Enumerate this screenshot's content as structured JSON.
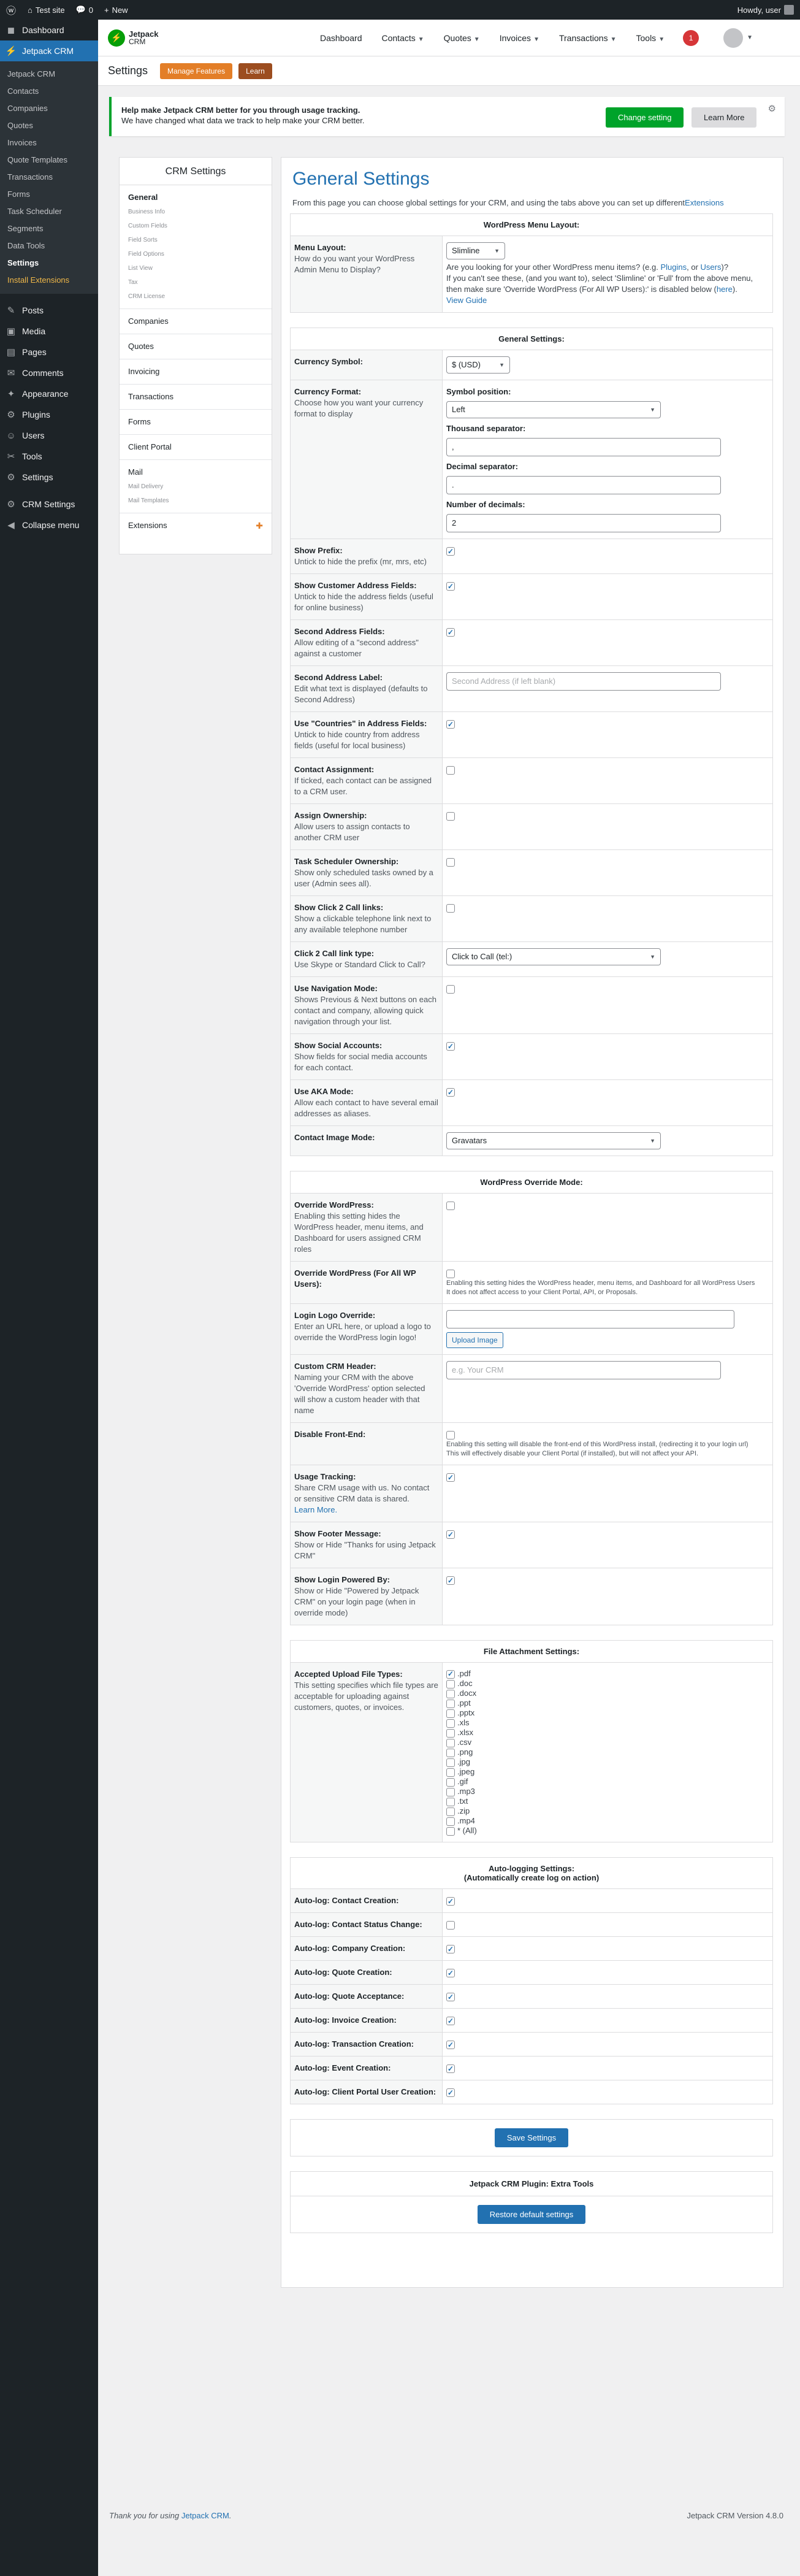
{
  "adminbar": {
    "site": "Test site",
    "comments": "0",
    "new": "New",
    "howdy": "Howdy, user"
  },
  "sidebar": {
    "top": [
      {
        "icon": "◼",
        "label": "Dashboard"
      }
    ],
    "crm_label": "Jetpack CRM",
    "crm_sub": [
      "Jetpack CRM",
      "Contacts",
      "Companies",
      "Quotes",
      "Invoices",
      "Quote Templates",
      "Transactions",
      "Forms",
      "Task Scheduler",
      "Segments",
      "Data Tools",
      "Settings",
      "Install Extensions"
    ],
    "bottom": [
      {
        "icon": "✎",
        "label": "Posts"
      },
      {
        "icon": "▣",
        "label": "Media"
      },
      {
        "icon": "▤",
        "label": "Pages"
      },
      {
        "icon": "✉",
        "label": "Comments"
      },
      {
        "icon": "✦",
        "label": "Appearance"
      },
      {
        "icon": "⚙",
        "label": "Plugins"
      },
      {
        "icon": "☺",
        "label": "Users"
      },
      {
        "icon": "✂",
        "label": "Tools"
      },
      {
        "icon": "⚙",
        "label": "Settings"
      },
      {
        "icon": "⚙",
        "label": "CRM Settings"
      },
      {
        "icon": "◀",
        "label": "Collapse menu"
      }
    ]
  },
  "topnav": {
    "brand1": "Jetpack",
    "brand2": "CRM",
    "links": [
      "Dashboard",
      "Contacts",
      "Quotes",
      "Invoices",
      "Transactions",
      "Tools"
    ],
    "notif": "1"
  },
  "subbar": {
    "title": "Settings",
    "manage": "Manage Features",
    "learn": "Learn"
  },
  "notice": {
    "line1": "Help make Jetpack CRM better for you through usage tracking.",
    "line2": "We have changed what data we track to help make your CRM better.",
    "btn_change": "Change setting",
    "btn_learn": "Learn More"
  },
  "snav": {
    "title": "CRM Settings",
    "groups": [
      {
        "main": "General",
        "subs": [
          "Business Info",
          "Custom Fields",
          "Field Sorts",
          "Field Options",
          "List View",
          "Tax",
          "CRM License"
        ]
      },
      {
        "main": "Companies",
        "subs": []
      },
      {
        "main": "Quotes",
        "subs": []
      },
      {
        "main": "Invoicing",
        "subs": []
      },
      {
        "main": "Transactions",
        "subs": []
      },
      {
        "main": "Forms",
        "subs": []
      },
      {
        "main": "Client Portal",
        "subs": []
      },
      {
        "main": "Mail",
        "subs": [
          "Mail Delivery",
          "Mail Templates"
        ]
      }
    ],
    "extensions": "Extensions"
  },
  "panel": {
    "title": "General Settings",
    "intro": "From this page you can choose global settings for your CRM, and using the tabs above you can set up different",
    "intro_link": "Extensions",
    "menu_layout": {
      "header": "WordPress Menu Layout:",
      "label": "Menu Layout:",
      "desc": "How do you want your WordPress Admin Menu to Display?",
      "value": "Slimline",
      "help1": "Are you looking for your other WordPress menu items? (e.g.",
      "plugins": "Plugins",
      "or": ", or",
      "users": "Users",
      "help1b": ")?",
      "help2": "If you can't see these, (and you want to), select 'Slimline' or 'Full' from the above menu, then make sure 'Override WordPress (For All WP Users):' is disabled below",
      "here": "here",
      "help3": ".",
      "guide": "View Guide"
    },
    "general": {
      "header": "General Settings:",
      "currency_label": "Currency Symbol:",
      "currency_value": "$ (USD)",
      "format_label": "Currency Format:",
      "format_desc": "Choose how you want your currency format to display",
      "symbol_pos_label": "Symbol position:",
      "symbol_pos_value": "Left",
      "thousand_label": "Thousand separator:",
      "thousand_value": ",",
      "decimal_label": "Decimal separator:",
      "decimal_value": ".",
      "decimals_label": "Number of decimals:",
      "decimals_value": "2"
    },
    "rows": [
      {
        "label": "Show Prefix:",
        "desc": "Untick to hide the prefix (mr, mrs, etc)",
        "type": "check",
        "on": true
      },
      {
        "label": "Show Customer Address Fields:",
        "desc": "Untick to hide the address fields (useful for online business)",
        "type": "check",
        "on": true
      },
      {
        "label": "Second Address Fields:",
        "desc": "Allow editing of a \"second address\" against a customer",
        "type": "check",
        "on": true
      },
      {
        "label": "Second Address Label:",
        "desc": "Edit what text is displayed (defaults to Second Address)",
        "type": "input",
        "placeholder": "Second Address (if left blank)"
      },
      {
        "label": "Use \"Countries\" in Address Fields:",
        "desc": "Untick to hide country from address fields (useful for local business)",
        "type": "check",
        "on": true
      },
      {
        "label": "Contact Assignment:",
        "desc": "If ticked, each contact can be assigned to a CRM user.",
        "type": "check",
        "on": false
      },
      {
        "label": "Assign Ownership:",
        "desc": "Allow users to assign contacts to another CRM user",
        "type": "check",
        "on": false
      },
      {
        "label": "Task Scheduler Ownership:",
        "desc": "Show only scheduled tasks owned by a user (Admin sees all).",
        "type": "check",
        "on": false
      },
      {
        "label": "Show Click 2 Call links:",
        "desc": "Show a clickable telephone link next to any available telephone number",
        "type": "check",
        "on": false
      },
      {
        "label": "Click 2 Call link type:",
        "desc": "Use Skype or Standard Click to Call?",
        "type": "select",
        "value": "Click to Call (tel:)"
      },
      {
        "label": "Use Navigation Mode:",
        "desc": "Shows Previous & Next buttons on each contact and company, allowing quick navigation through your list.",
        "type": "check",
        "on": false
      },
      {
        "label": "Show Social Accounts:",
        "desc": "Show fields for social media accounts for each contact.",
        "type": "check",
        "on": true
      },
      {
        "label": "Use AKA Mode:",
        "desc": "Allow each contact to have several email addresses as aliases.",
        "type": "check",
        "on": true
      },
      {
        "label": "Contact Image Mode:",
        "desc": "",
        "type": "select",
        "value": "Gravatars"
      }
    ],
    "override": {
      "header": "WordPress Override Mode:",
      "rows": [
        {
          "label": "Override WordPress:",
          "desc": "Enabling this setting hides the WordPress header, menu items, and Dashboard for users assigned CRM roles",
          "type": "check",
          "on": false
        },
        {
          "label": "Override WordPress (For All WP Users):",
          "desc": "",
          "type": "checknote",
          "on": false,
          "note1": "Enabling this setting hides the WordPress header, menu items, and Dashboard for all WordPress Users",
          "note2": "It does not affect access to your Client Portal, API, or Proposals."
        },
        {
          "label": "Login Logo Override:",
          "desc": "Enter an URL here, or upload a logo to override the WordPress login logo!",
          "type": "upload",
          "button": "Upload Image"
        },
        {
          "label": "Custom CRM Header:",
          "desc": "Naming your CRM with the above 'Override WordPress' option selected will show a custom header with that name",
          "type": "input",
          "placeholder": "e.g. Your CRM"
        },
        {
          "label": "Disable Front-End:",
          "desc": "",
          "type": "checknote",
          "on": false,
          "note1": "Enabling this setting will disable the front-end of this WordPress install, (redirecting it to your login url)",
          "note2": "This will effectively disable your Client Portal (if installed), but will not affect your API."
        },
        {
          "label": "Usage Tracking:",
          "desc": "Share CRM usage with us. No contact or sensitive CRM data is shared.",
          "link": "Learn More.",
          "type": "check",
          "on": true
        },
        {
          "label": "Show Footer Message:",
          "desc": "Show or Hide \"Thanks for using Jetpack CRM\"",
          "type": "check",
          "on": true
        },
        {
          "label": "Show Login Powered By:",
          "desc": "Show or Hide \"Powered by Jetpack CRM\" on your login page (when in override mode)",
          "type": "check",
          "on": true
        }
      ]
    },
    "files": {
      "header": "File Attachment Settings:",
      "label": "Accepted Upload File Types:",
      "desc": "This setting specifies which file types are acceptable for uploading against customers, quotes, or invoices.",
      "types": [
        {
          "n": ".pdf",
          "on": true
        },
        {
          "n": ".doc",
          "on": false
        },
        {
          "n": ".docx",
          "on": false
        },
        {
          "n": ".ppt",
          "on": false
        },
        {
          "n": ".pptx",
          "on": false
        },
        {
          "n": ".xls",
          "on": false
        },
        {
          "n": ".xlsx",
          "on": false
        },
        {
          "n": ".csv",
          "on": false
        },
        {
          "n": ".png",
          "on": false
        },
        {
          "n": ".jpg",
          "on": false
        },
        {
          "n": ".jpeg",
          "on": false
        },
        {
          "n": ".gif",
          "on": false
        },
        {
          "n": ".mp3",
          "on": false
        },
        {
          "n": ".txt",
          "on": false
        },
        {
          "n": ".zip",
          "on": false
        },
        {
          "n": ".mp4",
          "on": false
        },
        {
          "n": "* (All)",
          "on": false
        }
      ]
    },
    "autolog": {
      "header1": "Auto-logging Settings:",
      "header2": "(Automatically create log on action)",
      "rows": [
        {
          "label": "Auto-log: Contact Creation:",
          "on": true
        },
        {
          "label": "Auto-log: Contact Status Change:",
          "on": false
        },
        {
          "label": "Auto-log: Company Creation:",
          "on": true
        },
        {
          "label": "Auto-log: Quote Creation:",
          "on": true
        },
        {
          "label": "Auto-log: Quote Acceptance:",
          "on": true
        },
        {
          "label": "Auto-log: Invoice Creation:",
          "on": true
        },
        {
          "label": "Auto-log: Transaction Creation:",
          "on": true
        },
        {
          "label": "Auto-log: Event Creation:",
          "on": true
        },
        {
          "label": "Auto-log: Client Portal User Creation:",
          "on": true
        }
      ]
    },
    "save": "Save Settings",
    "tools_header": "Jetpack CRM Plugin: Extra Tools",
    "restore": "Restore default settings"
  },
  "footer": {
    "thanks": "Thank you for using",
    "brand": "Jetpack CRM",
    "dot": ".",
    "version": "Jetpack CRM Version 4.8.0"
  }
}
